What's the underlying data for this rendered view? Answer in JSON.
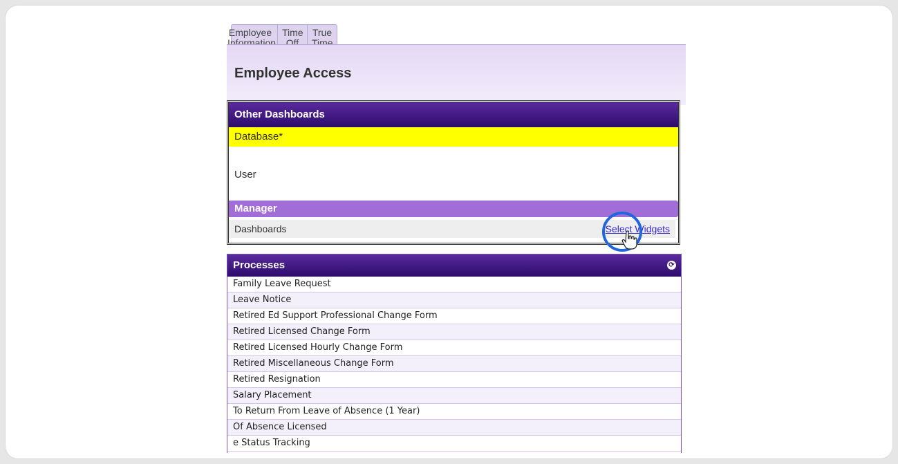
{
  "tabs": [
    "Employee Information",
    "Time Off",
    "True Time"
  ],
  "page": {
    "title": "Employee Access"
  },
  "dashboards": {
    "header": "Other Dashboards",
    "highlighted_row": "Database*",
    "user_row": "User",
    "manager_bar": "Manager",
    "footer_label": "Dashboards",
    "select_widgets": "Select Widgets"
  },
  "forms": {
    "header": "Processes",
    "items": [
      "Family Leave Request",
      "Leave Notice",
      "Retired Ed Support Professional Change Form",
      "Retired Licensed Change Form",
      "Retired Licensed Hourly Change Form",
      "Retired Miscellaneous Change Form",
      "Retired Resignation",
      "Salary Placement",
      "To Return From Leave of Absence (1 Year)",
      "Of Absence Licensed",
      "e Status Tracking"
    ]
  },
  "colors": {
    "header_purple": "#2d0c6b",
    "manager_purple": "#a06ed6",
    "highlight_yellow": "#ffff00",
    "cursor_ring": "#2266dd"
  }
}
